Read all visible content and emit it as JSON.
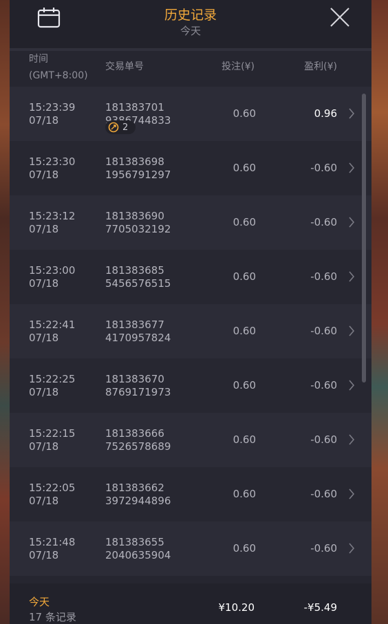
{
  "title": "历史记录",
  "subtitle": "今天",
  "header": {
    "time_label": "时间",
    "timezone": "(GMT+8:00)",
    "txn_label": "交易单号",
    "bet_label": "投注(¥)",
    "pl_label": "盈利(¥)"
  },
  "rows": [
    {
      "time": "15:23:39",
      "date": "07/18",
      "txn1": "181383701",
      "txn2": "9386744833",
      "bet": "0.60",
      "pl": "0.96",
      "win": true,
      "badge": "2"
    },
    {
      "time": "15:23:30",
      "date": "07/18",
      "txn1": "181383698",
      "txn2": "1956791297",
      "bet": "0.60",
      "pl": "-0.60",
      "win": false
    },
    {
      "time": "15:23:12",
      "date": "07/18",
      "txn1": "181383690",
      "txn2": "7705032192",
      "bet": "0.60",
      "pl": "-0.60",
      "win": false
    },
    {
      "time": "15:23:00",
      "date": "07/18",
      "txn1": "181383685",
      "txn2": "5456576515",
      "bet": "0.60",
      "pl": "-0.60",
      "win": false
    },
    {
      "time": "15:22:41",
      "date": "07/18",
      "txn1": "181383677",
      "txn2": "4170957824",
      "bet": "0.60",
      "pl": "-0.60",
      "win": false
    },
    {
      "time": "15:22:25",
      "date": "07/18",
      "txn1": "181383670",
      "txn2": "8769171973",
      "bet": "0.60",
      "pl": "-0.60",
      "win": false
    },
    {
      "time": "15:22:15",
      "date": "07/18",
      "txn1": "181383666",
      "txn2": "7526578689",
      "bet": "0.60",
      "pl": "-0.60",
      "win": false
    },
    {
      "time": "15:22:05",
      "date": "07/18",
      "txn1": "181383662",
      "txn2": "3972944896",
      "bet": "0.60",
      "pl": "-0.60",
      "win": false
    },
    {
      "time": "15:21:48",
      "date": "07/18",
      "txn1": "181383655",
      "txn2": "2040635904",
      "bet": "0.60",
      "pl": "-0.60",
      "win": false
    }
  ],
  "footer": {
    "label": "今天",
    "count": "17 条记录",
    "total_bet": "¥10.20",
    "total_pl": "-¥5.49"
  },
  "colors": {
    "accent": "#f2a93b",
    "panel": "#262630",
    "row_alt": "#2c2c37"
  },
  "icons": {
    "calendar": "calendar-icon",
    "close": "close-icon",
    "chevron": "chevron-right-icon",
    "bonus": "bonus-icon"
  }
}
